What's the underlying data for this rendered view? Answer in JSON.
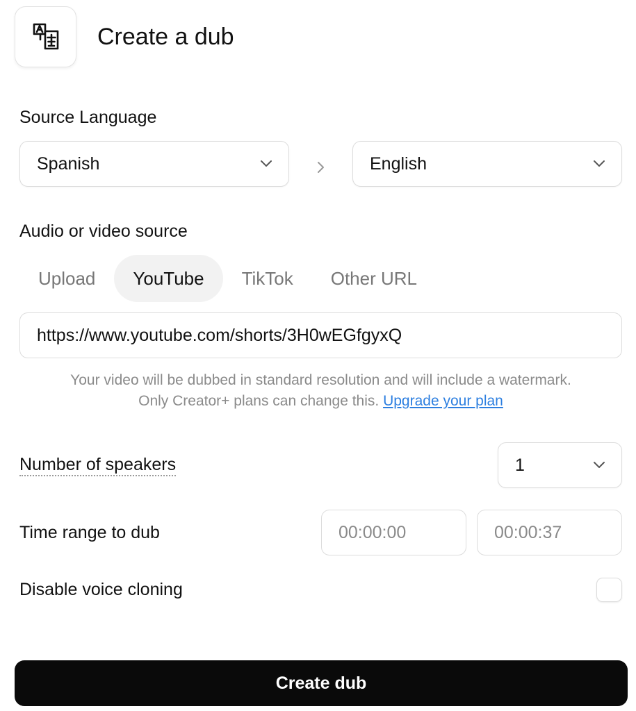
{
  "header": {
    "title": "Create a dub",
    "icon": "translate-icon"
  },
  "source_language": {
    "label": "Source Language",
    "source_value": "Spanish",
    "target_value": "English"
  },
  "media_source": {
    "label": "Audio or video source",
    "tabs": [
      {
        "label": "Upload",
        "active": false
      },
      {
        "label": "YouTube",
        "active": true
      },
      {
        "label": "TikTok",
        "active": false
      },
      {
        "label": "Other URL",
        "active": false
      }
    ],
    "url_value": "https://www.youtube.com/shorts/3H0wEGfgyxQ"
  },
  "notice": {
    "line1": "Your video will be dubbed in standard resolution and will include a watermark.",
    "line2": "Only Creator+ plans can change this. ",
    "link": "Upgrade your plan"
  },
  "speakers": {
    "label": "Number of speakers",
    "value": "1"
  },
  "time_range": {
    "label": "Time range to dub",
    "start": "00:00:00",
    "end": "00:00:37"
  },
  "voice_cloning": {
    "label": "Disable voice cloning",
    "checked": false
  },
  "submit": {
    "label": "Create dub"
  },
  "colors": {
    "primary": "#0a0a0a",
    "link": "#2d7fe0",
    "muted": "#8a8a8a",
    "tab_active_bg": "#f2f2f2"
  }
}
